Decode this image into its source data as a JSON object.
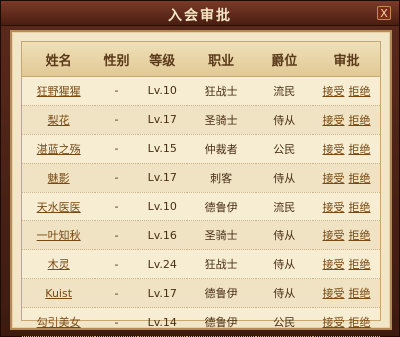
{
  "window": {
    "title": "入会审批",
    "close_label": "X"
  },
  "table": {
    "headers": [
      "姓名",
      "性别",
      "等级",
      "职业",
      "爵位",
      "审批"
    ],
    "rows": [
      {
        "name": "狂野猩猩",
        "gender": "-",
        "level": "Lv.10",
        "class": "狂战士",
        "rank": "流民"
      },
      {
        "name": "梨花",
        "gender": "-",
        "level": "Lv.17",
        "class": "圣骑士",
        "rank": "侍从"
      },
      {
        "name": "湛蓝之殇",
        "gender": "-",
        "level": "Lv.15",
        "class": "仲裁者",
        "rank": "公民"
      },
      {
        "name": "魅影",
        "gender": "-",
        "level": "Lv.17",
        "class": "刺客",
        "rank": "侍从"
      },
      {
        "name": "天水医医",
        "gender": "-",
        "level": "Lv.10",
        "class": "德鲁伊",
        "rank": "流民"
      },
      {
        "name": "一叶知秋",
        "gender": "-",
        "level": "Lv.16",
        "class": "圣骑士",
        "rank": "侍从"
      },
      {
        "name": "木灵",
        "gender": "-",
        "level": "Lv.24",
        "class": "狂战士",
        "rank": "侍从"
      },
      {
        "name": "Kuist",
        "gender": "-",
        "level": "Lv.17",
        "class": "德鲁伊",
        "rank": "侍从"
      },
      {
        "name": "勾引美女",
        "gender": "-",
        "level": "Lv.14",
        "class": "德鲁伊",
        "rank": "公民"
      }
    ],
    "accept_label": "接受",
    "reject_label": "拒绝"
  }
}
